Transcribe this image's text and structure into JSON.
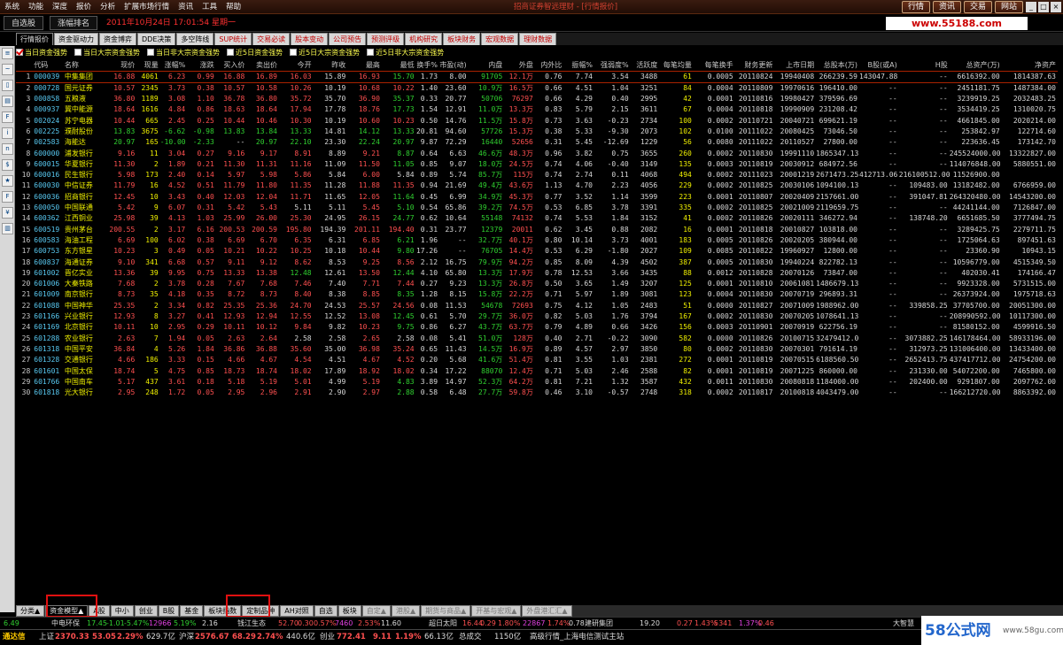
{
  "menu": [
    "系统",
    "功能",
    "深度",
    "报价",
    "分析",
    "扩展市场行情",
    "资讯",
    "工具",
    "帮助"
  ],
  "window_title": "招商证券智远理财 - [行情报价]",
  "right_buttons": [
    "行情",
    "资讯",
    "交易",
    "网站"
  ],
  "top": {
    "tab1": "自选股",
    "tab2": "涨幅排名",
    "datetime": "2011年10月24日  17:01:54 星期一",
    "site": "www.55188.com"
  },
  "tabs": [
    {
      "label": "行情报价",
      "red": false
    },
    {
      "label": "资金驱动力",
      "red": false
    },
    {
      "label": "资金博弈",
      "red": false
    },
    {
      "label": "DDE决策",
      "red": false
    },
    {
      "label": "多空阵线",
      "red": false
    },
    {
      "label": "SUP统计",
      "red": true
    },
    {
      "label": "交易必读",
      "red": true
    },
    {
      "label": "股本变动",
      "red": true
    },
    {
      "label": "公司预告",
      "red": true
    },
    {
      "label": "预测评级",
      "red": true
    },
    {
      "label": "机构研究",
      "red": true
    },
    {
      "label": "板块财务",
      "red": true
    },
    {
      "label": "宏观数据",
      "red": true
    },
    {
      "label": "理财数据",
      "red": true
    }
  ],
  "filters": [
    {
      "label": "当日资金强势",
      "checked": true
    },
    {
      "label": "当日大宗资金强势",
      "checked": false
    },
    {
      "label": "当日非大宗资金强势",
      "checked": false
    },
    {
      "label": "近5日资金强势",
      "checked": false
    },
    {
      "label": "近5日大宗资金强势",
      "checked": false
    },
    {
      "label": "近5日非大宗资金强势",
      "checked": false
    }
  ],
  "left_icons": [
    "list-icon",
    "chart-icon",
    "kline-icon",
    "report-icon",
    "f10-icon",
    "info-icon",
    "news-icon",
    "trade-icon",
    "pick-icon",
    "f10-icon",
    "funds-icon",
    "bar-icon"
  ],
  "left_icon_glyphs": [
    "≡",
    "~",
    "▯",
    "▤",
    "F",
    "i",
    "n",
    "$",
    "★",
    "F",
    "¥",
    "▥"
  ],
  "columns": [
    "",
    "代码",
    "名称",
    "现价",
    "现量",
    "涨幅%",
    "涨跌",
    "买入价",
    "卖出价",
    "今开",
    "昨收",
    "最高",
    "最低",
    "换手%",
    "市盈(动)",
    "内盘",
    "外盘",
    "内外比",
    "振幅%",
    "强弱度%",
    "活跃度",
    "每笔均量",
    "每笔换手",
    "财务更新",
    "上市日期",
    "总股本(万)",
    "B股(或A)",
    "H股",
    "总资产(万)",
    "净资产"
  ],
  "rows": [
    [
      "1",
      "000039",
      "中集集团",
      "16.88",
      "4061",
      "6.23",
      "0.99",
      "16.88",
      "16.89",
      "16.03",
      "15.89",
      "16.93",
      "15.70",
      "1.73",
      "8.00",
      "91705",
      "12.1万",
      "0.76",
      "7.74",
      "3.54",
      "3488",
      "61",
      "0.0005",
      "20110824",
      "19940408",
      "266239.59",
      "143047.88",
      "--",
      "6616392.00",
      "1814387.63"
    ],
    [
      "2",
      "000728",
      "国元证券",
      "10.57",
      "2345",
      "3.73",
      "0.38",
      "10.57",
      "10.58",
      "10.26",
      "10.19",
      "10.68",
      "10.22",
      "1.40",
      "23.60",
      "10.9万",
      "16.5万",
      "0.66",
      "4.51",
      "1.04",
      "3251",
      "84",
      "0.0004",
      "20110809",
      "19970616",
      "196410.00",
      "--",
      "--",
      "2451181.75",
      "1487384.00"
    ],
    [
      "3",
      "000858",
      "五粮液",
      "36.80",
      "1189",
      "3.08",
      "1.10",
      "36.78",
      "36.80",
      "35.72",
      "35.70",
      "36.90",
      "35.37",
      "0.33",
      "20.77",
      "50706",
      "76297",
      "0.66",
      "4.29",
      "0.40",
      "2995",
      "42",
      "0.0001",
      "20110816",
      "19980427",
      "379596.69",
      "--",
      "--",
      "3239919.25",
      "2032483.25"
    ],
    [
      "4",
      "000937",
      "冀中能源",
      "18.64",
      "1616",
      "4.84",
      "0.86",
      "18.63",
      "18.64",
      "17.94",
      "17.78",
      "18.76",
      "17.73",
      "1.54",
      "12.91",
      "11.0万",
      "13.3万",
      "0.83",
      "5.79",
      "2.15",
      "3611",
      "67",
      "0.0004",
      "20110818",
      "19990909",
      "231208.42",
      "--",
      "--",
      "3534419.25",
      "1310020.75"
    ],
    [
      "5",
      "002024",
      "苏宁电器",
      "10.44",
      "665",
      "2.45",
      "0.25",
      "10.44",
      "10.46",
      "10.30",
      "10.19",
      "10.60",
      "10.23",
      "0.50",
      "14.76",
      "11.5万",
      "15.8万",
      "0.73",
      "3.63",
      "-0.23",
      "2734",
      "100",
      "0.0002",
      "20110721",
      "20040721",
      "699621.19",
      "--",
      "--",
      "4661845.00",
      "2020214.00"
    ],
    [
      "6",
      "002225",
      "濮耐股份",
      "13.83",
      "3675",
      "-6.62",
      "-0.98",
      "13.83",
      "13.84",
      "13.33",
      "14.81",
      "14.12",
      "13.33",
      "20.81",
      "94.60",
      "57726",
      "15.3万",
      "0.38",
      "5.33",
      "-9.30",
      "2073",
      "102",
      "0.0100",
      "20111022",
      "20080425",
      "73046.50",
      "--",
      "--",
      "253842.97",
      "122714.60"
    ],
    [
      "7",
      "002583",
      "海能达",
      "20.97",
      "165",
      "-10.00",
      "-2.33",
      "--",
      "20.97",
      "22.10",
      "23.30",
      "22.24",
      "20.97",
      "9.87",
      "72.29",
      "16440",
      "52656",
      "0.31",
      "5.45",
      "-12.69",
      "1229",
      "56",
      "0.0080",
      "20111022",
      "20110527",
      "27800.00",
      "--",
      "--",
      "223636.45",
      "173142.70"
    ],
    [
      "8",
      "600000",
      "浦发银行",
      "9.16",
      "11",
      "3.04",
      "0.27",
      "9.16",
      "9.17",
      "8.91",
      "8.89",
      "9.21",
      "8.87",
      "0.64",
      "6.63",
      "46.6万",
      "48.3万",
      "0.96",
      "3.82",
      "0.75",
      "3655",
      "260",
      "0.0002",
      "20110830",
      "19991110",
      "1865347.13",
      "--",
      "--",
      "245524000.00",
      "13322827.00"
    ],
    [
      "9",
      "600015",
      "华夏银行",
      "11.30",
      "2",
      "1.89",
      "0.21",
      "11.30",
      "11.31",
      "11.16",
      "11.09",
      "11.50",
      "11.05",
      "0.85",
      "9.07",
      "18.0万",
      "24.5万",
      "0.74",
      "4.06",
      "-0.40",
      "3149",
      "135",
      "0.0003",
      "20110819",
      "20030912",
      "684972.56",
      "--",
      "--",
      "114076848.00",
      "5880551.00"
    ],
    [
      "10",
      "600016",
      "民生银行",
      "5.98",
      "173",
      "2.40",
      "0.14",
      "5.97",
      "5.98",
      "5.86",
      "5.84",
      "6.00",
      "5.84",
      "0.89",
      "5.74",
      "85.7万",
      "115万",
      "0.74",
      "2.74",
      "0.11",
      "4068",
      "494",
      "0.0002",
      "20111023",
      "20001219",
      "2671473.25",
      "412713.06",
      "216100512.00",
      "11526900.00"
    ],
    [
      "11",
      "600030",
      "中信证券",
      "11.79",
      "16",
      "4.52",
      "0.51",
      "11.79",
      "11.80",
      "11.35",
      "11.28",
      "11.88",
      "11.35",
      "0.94",
      "21.69",
      "49.4万",
      "43.6万",
      "1.13",
      "4.70",
      "2.23",
      "4056",
      "229",
      "0.0002",
      "20110825",
      "20030106",
      "1094100.13",
      "--",
      "109483.00",
      "13182482.00",
      "6766959.00"
    ],
    [
      "12",
      "600036",
      "招商银行",
      "12.45",
      "10",
      "3.43",
      "0.40",
      "12.03",
      "12.04",
      "11.71",
      "11.65",
      "12.05",
      "11.64",
      "0.45",
      "6.99",
      "34.9万",
      "45.3万",
      "0.77",
      "3.52",
      "1.14",
      "3599",
      "223",
      "0.0001",
      "20110807",
      "20020409",
      "2157661.00",
      "--",
      "391047.81",
      "264320480.00",
      "14543200.00"
    ],
    [
      "13",
      "600050",
      "中国联通",
      "5.42",
      "9",
      "6.07",
      "0.31",
      "5.42",
      "5.43",
      "5.11",
      "5.11",
      "5.45",
      "5.10",
      "0.54",
      "65.86",
      "39.2万",
      "74.5万",
      "0.53",
      "6.85",
      "3.78",
      "3391",
      "335",
      "0.0002",
      "20110825",
      "20021009",
      "2119659.75",
      "--",
      "--",
      "44241144.00",
      "7126847.00"
    ],
    [
      "14",
      "600362",
      "江西铜业",
      "25.98",
      "39",
      "4.13",
      "1.03",
      "25.99",
      "26.00",
      "25.30",
      "24.95",
      "26.15",
      "24.77",
      "0.62",
      "10.64",
      "55148",
      "74132",
      "0.74",
      "5.53",
      "1.84",
      "3152",
      "41",
      "0.0002",
      "20110826",
      "20020111",
      "346272.94",
      "--",
      "138748.20",
      "6651685.50",
      "3777494.75"
    ],
    [
      "15",
      "600519",
      "贵州茅台",
      "200.55",
      "2",
      "3.17",
      "6.16",
      "200.53",
      "200.59",
      "195.80",
      "194.39",
      "201.11",
      "194.40",
      "0.31",
      "23.77",
      "12379",
      "20011",
      "0.62",
      "3.45",
      "0.88",
      "2082",
      "16",
      "0.0001",
      "20110818",
      "20010827",
      "103818.00",
      "--",
      "--",
      "3289425.75",
      "2279711.75"
    ],
    [
      "16",
      "600583",
      "海油工程",
      "6.69",
      "100",
      "6.02",
      "0.38",
      "6.69",
      "6.70",
      "6.35",
      "6.31",
      "6.85",
      "6.21",
      "1.96",
      "--",
      "32.7万",
      "40.1万",
      "0.80",
      "10.14",
      "3.73",
      "4001",
      "183",
      "0.0005",
      "20110826",
      "20020205",
      "380944.00",
      "--",
      "--",
      "1725064.63",
      "897451.63"
    ],
    [
      "17",
      "600753",
      "东方银星",
      "10.23",
      "3",
      "0.49",
      "0.05",
      "10.21",
      "10.22",
      "10.25",
      "10.18",
      "10.44",
      "9.80",
      "17.26",
      "--",
      "76705",
      "14.4万",
      "0.53",
      "6.29",
      "-1.80",
      "2027",
      "109",
      "0.0085",
      "20110822",
      "19960927",
      "12800.00",
      "--",
      "--",
      "23360.90",
      "10943.15"
    ],
    [
      "18",
      "600837",
      "海通证券",
      "9.10",
      "341",
      "6.68",
      "0.57",
      "9.11",
      "9.12",
      "8.62",
      "8.53",
      "9.25",
      "8.56",
      "2.12",
      "16.75",
      "79.9万",
      "94.2万",
      "0.85",
      "8.09",
      "4.39",
      "4502",
      "387",
      "0.0005",
      "20110830",
      "19940224",
      "822782.13",
      "--",
      "--",
      "10596779.00",
      "4515349.50"
    ],
    [
      "19",
      "601002",
      "晋亿实业",
      "13.36",
      "39",
      "9.95",
      "0.75",
      "13.33",
      "13.38",
      "12.48",
      "12.61",
      "13.50",
      "12.44",
      "4.10",
      "65.80",
      "13.3万",
      "17.9万",
      "0.78",
      "12.53",
      "3.66",
      "3435",
      "88",
      "0.0012",
      "20110828",
      "20070126",
      "73847.00",
      "--",
      "--",
      "402030.41",
      "174166.47"
    ],
    [
      "20",
      "601006",
      "大秦铁路",
      "7.68",
      "2",
      "3.78",
      "0.28",
      "7.67",
      "7.68",
      "7.46",
      "7.40",
      "7.71",
      "7.44",
      "0.27",
      "9.23",
      "13.3万",
      "26.8万",
      "0.50",
      "3.65",
      "1.49",
      "3207",
      "125",
      "0.0001",
      "20110810",
      "20061081",
      "1486679.13",
      "--",
      "--",
      "9923328.00",
      "5731515.00"
    ],
    [
      "21",
      "601009",
      "南京银行",
      "8.73",
      "35",
      "4.18",
      "0.35",
      "8.72",
      "8.73",
      "8.40",
      "8.38",
      "8.85",
      "8.35",
      "1.28",
      "8.15",
      "15.8万",
      "22.2万",
      "0.71",
      "5.97",
      "1.89",
      "3081",
      "123",
      "0.0004",
      "20110830",
      "20070719",
      "296893.31",
      "--",
      "--",
      "26373924.00",
      "1975718.63"
    ],
    [
      "22",
      "601088",
      "中国神华",
      "25.35",
      "2",
      "3.34",
      "0.82",
      "25.35",
      "25.36",
      "24.70",
      "24.53",
      "25.57",
      "24.56",
      "0.08",
      "11.53",
      "54678",
      "72693",
      "0.75",
      "4.12",
      "1.05",
      "2483",
      "51",
      "0.0000",
      "20110827",
      "20071009",
      "1988962.00",
      "--",
      "339858.25",
      "37705700.00",
      "20051300.00"
    ],
    [
      "23",
      "601166",
      "兴业银行",
      "12.93",
      "8",
      "3.27",
      "0.41",
      "12.93",
      "12.94",
      "12.55",
      "12.52",
      "13.08",
      "12.45",
      "0.61",
      "5.70",
      "29.7万",
      "36.0万",
      "0.82",
      "5.03",
      "1.76",
      "3794",
      "167",
      "0.0002",
      "20110830",
      "20070205",
      "1078641.13",
      "--",
      "--",
      "208990592.00",
      "10117300.00"
    ],
    [
      "24",
      "601169",
      "北京银行",
      "10.11",
      "10",
      "2.95",
      "0.29",
      "10.11",
      "10.12",
      "9.84",
      "9.82",
      "10.23",
      "9.75",
      "0.86",
      "6.27",
      "43.7万",
      "63.7万",
      "0.79",
      "4.89",
      "0.66",
      "3426",
      "156",
      "0.0003",
      "20110901",
      "20070919",
      "622756.19",
      "--",
      "--",
      "81580152.00",
      "4599916.50"
    ],
    [
      "25",
      "601288",
      "农业银行",
      "2.63",
      "7",
      "1.94",
      "0.05",
      "2.63",
      "2.64",
      "2.58",
      "2.58",
      "2.65",
      "2.58",
      "0.08",
      "5.41",
      "51.0万",
      "128万",
      "0.40",
      "2.71",
      "-0.22",
      "3090",
      "582",
      "0.0000",
      "20110826",
      "20100715",
      "32479412.00",
      "--",
      "3073882.25",
      "146178464.00",
      "58933196.00"
    ],
    [
      "26",
      "601318",
      "中国平安",
      "36.84",
      "4",
      "5.26",
      "1.84",
      "36.86",
      "36.88",
      "35.60",
      "35.00",
      "36.98",
      "35.24",
      "0.65",
      "11.43",
      "14.5万",
      "16.9万",
      "0.89",
      "4.57",
      "2.97",
      "3850",
      "80",
      "0.0002",
      "20110830",
      "20070301",
      "791614.19",
      "--",
      "312973.25",
      "131006400.00",
      "13433400.00"
    ],
    [
      "27",
      "601328",
      "交通银行",
      "4.66",
      "186",
      "3.33",
      "0.15",
      "4.66",
      "4.67",
      "4.54",
      "4.51",
      "4.67",
      "4.52",
      "0.20",
      "5.68",
      "41.6万",
      "51.4万",
      "0.81",
      "3.55",
      "1.03",
      "2381",
      "272",
      "0.0001",
      "20110819",
      "20070515",
      "6188560.50",
      "--",
      "2652413.75",
      "437417712.00",
      "24754200.00"
    ],
    [
      "28",
      "601601",
      "中国太保",
      "18.74",
      "5",
      "4.75",
      "0.85",
      "18.73",
      "18.74",
      "18.02",
      "17.89",
      "18.92",
      "18.02",
      "0.34",
      "17.22",
      "88070",
      "12.4万",
      "0.71",
      "5.03",
      "2.46",
      "2588",
      "82",
      "0.0001",
      "20110819",
      "20071225",
      "860000.00",
      "--",
      "231330.00",
      "54072200.00",
      "7465800.00"
    ],
    [
      "29",
      "601766",
      "中国南车",
      "5.17",
      "437",
      "3.61",
      "0.18",
      "5.18",
      "5.19",
      "5.01",
      "4.99",
      "5.19",
      "4.83",
      "3.89",
      "14.97",
      "52.3万",
      "64.2万",
      "0.81",
      "7.21",
      "1.32",
      "3587",
      "432",
      "0.0011",
      "20110830",
      "20080818",
      "1184000.00",
      "--",
      "202400.00",
      "9291807.00",
      "2097762.00"
    ],
    [
      "30",
      "601818",
      "光大银行",
      "2.95",
      "248",
      "1.72",
      "0.05",
      "2.95",
      "2.96",
      "2.91",
      "2.90",
      "2.97",
      "2.88",
      "0.58",
      "6.48",
      "27.7万",
      "59.8万",
      "0.46",
      "3.10",
      "-0.57",
      "2748",
      "318",
      "0.0002",
      "20110817",
      "20100818",
      "4043479.00",
      "--",
      "--",
      "166212720.00",
      "8863392.00"
    ]
  ],
  "bottom_tabs": [
    "分类▲",
    "资金模型▲",
    "A股",
    "中小",
    "创业",
    "B股",
    "基金",
    "板块指数",
    "定制品种",
    "AH对照",
    "自选",
    "板块",
    "自定▲",
    "港股▲",
    "期货与商品▲",
    "开基与宏观▲",
    "外盘港汇汇▲"
  ],
  "ticker": [
    "6.49",
    "中电环保",
    "17.45",
    "-1.01",
    "-5.47%",
    "12966",
    "5.19%",
    "2.16",
    "钱江生态",
    "52.70",
    "0.30",
    "0.57%",
    "7460",
    "2.53%",
    "11.60",
    "超日太阳",
    "16.44",
    "0.29",
    "1.80%",
    "22867",
    "1.74%",
    "0.78",
    "建研集团",
    "19.20",
    "0.27",
    "1.43%",
    "5341",
    "1.37%",
    "0.46",
    "大智慧"
  ],
  "status": {
    "brand": "通达信",
    "sh_label": "上证",
    "sh_val": "2370.33",
    "sh_chg": "53.05",
    "sh_pct": "2.29%",
    "sh_amt": "629.7亿",
    "sz_label": "沪深",
    "sz_val": "2576.67",
    "sz_chg": "68.29",
    "sz_pct": "2.74%",
    "sz_amt": "440.6亿",
    "cy_label": "创业",
    "cy_val": "772.41",
    "cy_chg": "9.11",
    "cy_pct": "1.19%",
    "cy_amt": "66.13亿",
    "total_label": "总成交",
    "total_amt": "1150亿",
    "server": "高级行情_上海电信测试主站"
  },
  "logo": {
    "big": "58公式网",
    "small": "www.58gu.com"
  }
}
